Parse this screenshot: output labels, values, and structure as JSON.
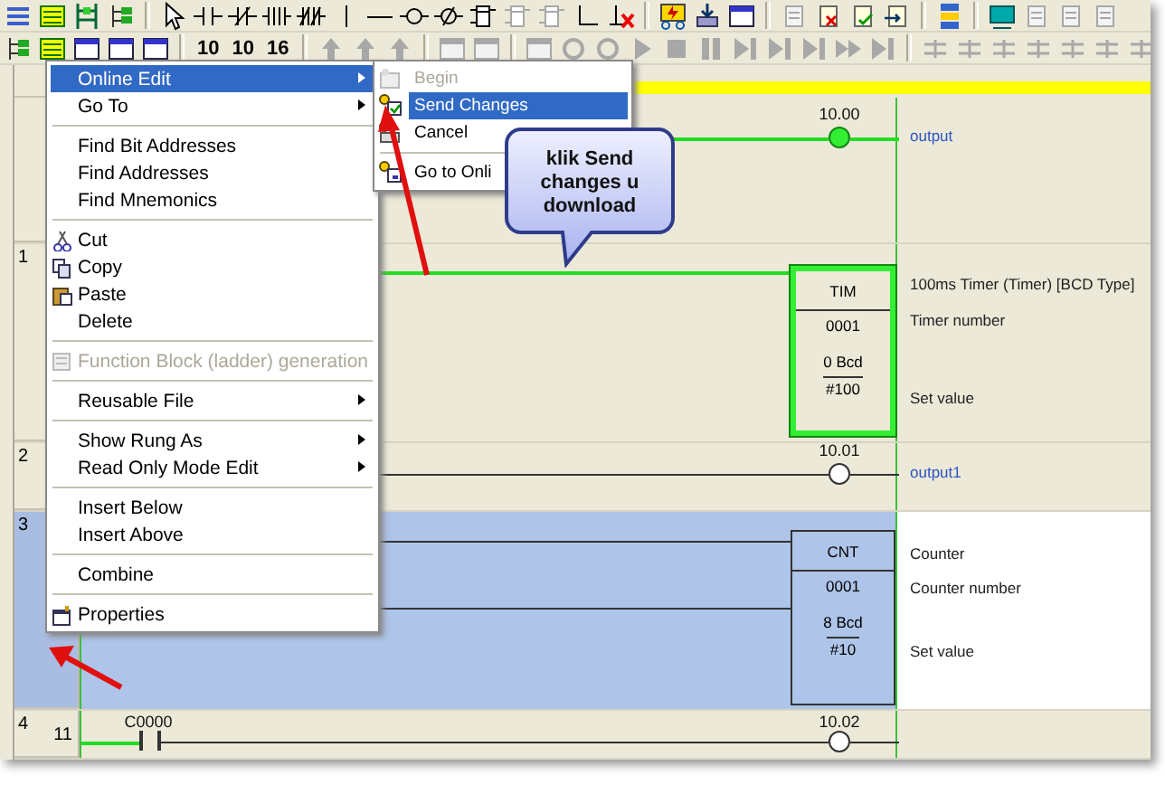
{
  "toolbar": {
    "counters": [
      "10",
      "10",
      "16"
    ]
  },
  "ladder": {
    "header": {
      "highlighted": true
    },
    "rungs": [
      {
        "kind": "output",
        "coil": "10.00",
        "comment": "output",
        "energized": true,
        "selected": false
      },
      {
        "kind": "timer",
        "number": "1",
        "instruction": "TIM",
        "operand": "0001",
        "present": "0 Bcd",
        "set": "#100",
        "comments": [
          "100ms Timer (Timer) [BCD Type]",
          "Timer number",
          "Set value"
        ],
        "energized": true,
        "selected": false
      },
      {
        "kind": "output",
        "number": "2",
        "coil": "10.01",
        "comment": "output1",
        "energized": false,
        "selected": false
      },
      {
        "kind": "counter",
        "number": "3",
        "instruction": "CNT",
        "operand": "0001",
        "present": "8 Bcd",
        "set": "#10",
        "comments": [
          "Counter",
          "Counter number",
          "Set value"
        ],
        "energized": false,
        "selected": true
      },
      {
        "kind": "contact",
        "number": "4",
        "step": "11",
        "contact": "C0000",
        "coil": "10.02",
        "energized": false,
        "selected": false
      }
    ]
  },
  "context_menu": {
    "items": [
      {
        "kind": "item",
        "label": "Online Edit",
        "icon": false,
        "submenu": true,
        "selected": true,
        "disabled": false
      },
      {
        "kind": "item",
        "label": "Go To",
        "icon": false,
        "submenu": true,
        "selected": false,
        "disabled": false
      },
      {
        "kind": "separator"
      },
      {
        "kind": "item",
        "label": "Find Bit Addresses",
        "icon": false,
        "submenu": false,
        "selected": false,
        "disabled": false
      },
      {
        "kind": "item",
        "label": "Find Addresses",
        "icon": false,
        "submenu": false,
        "selected": false,
        "disabled": false
      },
      {
        "kind": "item",
        "label": "Find Mnemonics",
        "icon": false,
        "submenu": false,
        "selected": false,
        "disabled": false
      },
      {
        "kind": "separator"
      },
      {
        "kind": "item",
        "label": "Cut",
        "icon": true,
        "submenu": false,
        "selected": false,
        "disabled": false
      },
      {
        "kind": "item",
        "label": "Copy",
        "icon": true,
        "submenu": false,
        "selected": false,
        "disabled": false
      },
      {
        "kind": "item",
        "label": "Paste",
        "icon": true,
        "submenu": false,
        "selected": false,
        "disabled": false
      },
      {
        "kind": "item",
        "label": "Delete",
        "icon": false,
        "submenu": false,
        "selected": false,
        "disabled": false
      },
      {
        "kind": "separator"
      },
      {
        "kind": "item",
        "label": "Function Block (ladder) generation",
        "icon": true,
        "submenu": false,
        "selected": false,
        "disabled": true
      },
      {
        "kind": "separator"
      },
      {
        "kind": "item",
        "label": "Reusable File",
        "icon": false,
        "submenu": true,
        "selected": false,
        "disabled": false
      },
      {
        "kind": "separator"
      },
      {
        "kind": "item",
        "label": "Show Rung As",
        "icon": false,
        "submenu": true,
        "selected": false,
        "disabled": false
      },
      {
        "kind": "item",
        "label": "Read Only Mode Edit",
        "icon": false,
        "submenu": true,
        "selected": false,
        "disabled": false
      },
      {
        "kind": "separator"
      },
      {
        "kind": "item",
        "label": "Insert Below",
        "icon": false,
        "submenu": false,
        "selected": false,
        "disabled": false
      },
      {
        "kind": "item",
        "label": "Insert Above",
        "icon": false,
        "submenu": false,
        "selected": false,
        "disabled": false
      },
      {
        "kind": "separator"
      },
      {
        "kind": "item",
        "label": "Combine",
        "icon": false,
        "submenu": false,
        "selected": false,
        "disabled": false
      },
      {
        "kind": "separator"
      },
      {
        "kind": "item",
        "label": "Properties",
        "icon": true,
        "submenu": false,
        "selected": false,
        "disabled": false
      }
    ]
  },
  "submenu": {
    "items": [
      {
        "kind": "item",
        "label": "Begin",
        "selected": false,
        "disabled": true
      },
      {
        "kind": "item",
        "label": "Send Changes",
        "selected": true,
        "disabled": false
      },
      {
        "kind": "item",
        "label": "Cancel",
        "selected": false,
        "disabled": false
      },
      {
        "kind": "separator"
      },
      {
        "kind": "item",
        "label": "Go to Onli",
        "selected": false,
        "disabled": false
      }
    ]
  },
  "callout": {
    "text": "klik Send changes u download"
  }
}
